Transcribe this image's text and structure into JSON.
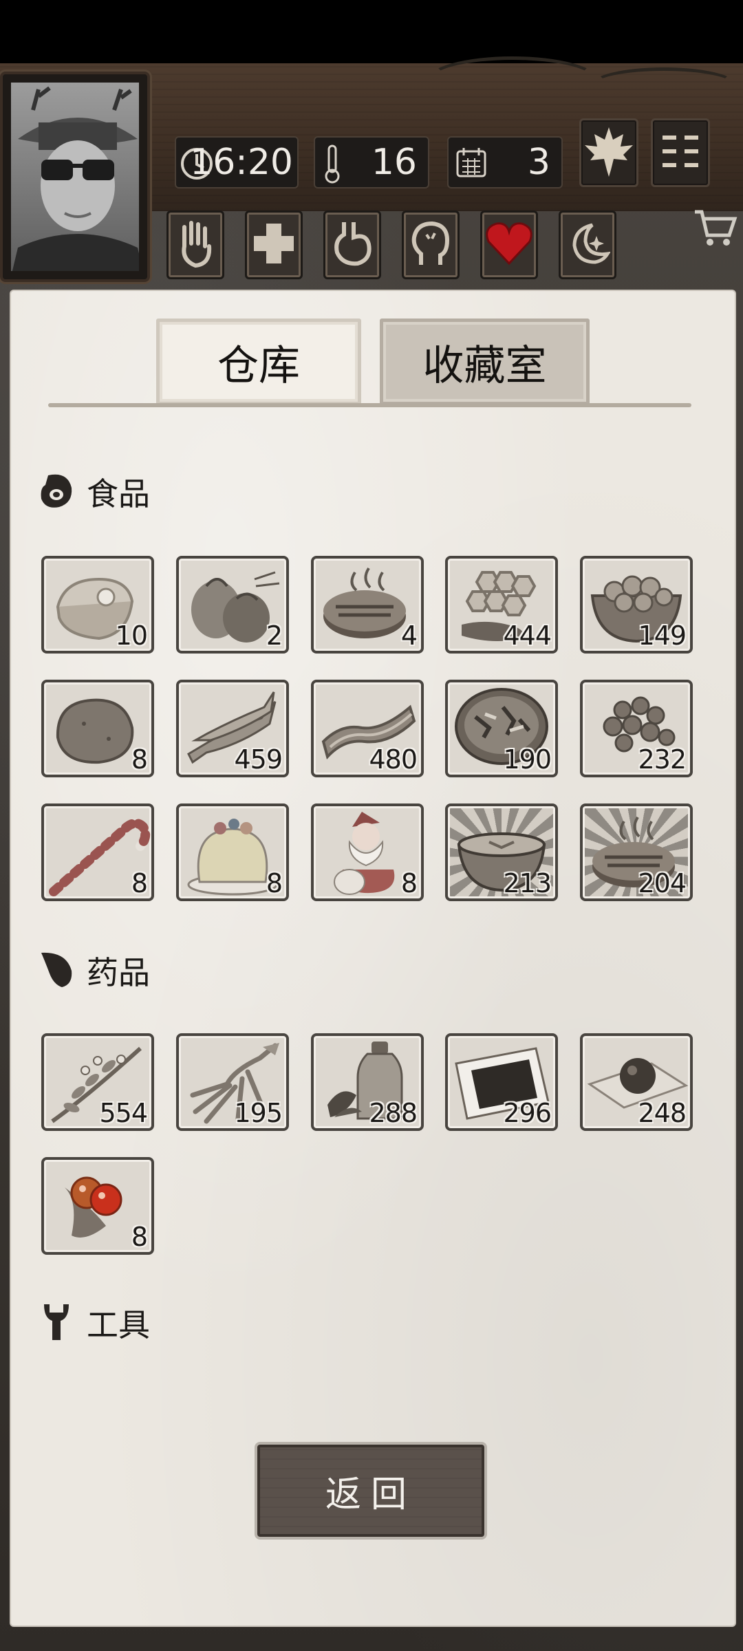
{
  "hud": {
    "time": "16:20",
    "temperature": "16",
    "day": "3",
    "icons": {
      "time": "clock-icon",
      "temperature": "thermometer-icon",
      "day": "calendar-icon",
      "season": "maple-leaf-icon",
      "menu": "menu-icon",
      "shop": "shopping-cart-icon"
    },
    "status": [
      "hand-icon",
      "health-cross-icon",
      "stomach-icon",
      "head-icon",
      "heart-icon",
      "moon-icon"
    ],
    "colors": {
      "heart": "#c0171d",
      "wood": "#3e2f24",
      "paper": "#ece8e1"
    }
  },
  "tabs": [
    {
      "label": "仓库",
      "active": true
    },
    {
      "label": "收藏室",
      "active": false
    }
  ],
  "sections": {
    "food": {
      "label": "食品",
      "icon": "meat-icon",
      "items": [
        {
          "icon": "raw-meat-icon",
          "count": "10"
        },
        {
          "icon": "coconut-icon",
          "count": "2"
        },
        {
          "icon": "grilled-steak-icon",
          "count": "4"
        },
        {
          "icon": "honeycomb-icon",
          "count": "444"
        },
        {
          "icon": "nut-bowl-icon",
          "count": "149"
        },
        {
          "icon": "potato-icon",
          "count": "8"
        },
        {
          "icon": "dried-fish-icon",
          "count": "459"
        },
        {
          "icon": "bacon-icon",
          "count": "480"
        },
        {
          "icon": "salad-bowl-icon",
          "count": "190"
        },
        {
          "icon": "berries-icon",
          "count": "232"
        },
        {
          "icon": "candy-cane-icon",
          "count": "8"
        },
        {
          "icon": "pudding-cake-icon",
          "count": "8"
        },
        {
          "icon": "santa-icon",
          "count": "8"
        },
        {
          "icon": "soup-bowl-icon",
          "count": "213"
        },
        {
          "icon": "grilled-steak-icon",
          "count": "204"
        }
      ]
    },
    "medicine": {
      "label": "药品",
      "icon": "leaf-icon",
      "items": [
        {
          "icon": "herb-branch-icon",
          "count": "554"
        },
        {
          "icon": "ginseng-root-icon",
          "count": "195"
        },
        {
          "icon": "tonic-bottle-icon",
          "count": "288"
        },
        {
          "icon": "plaster-icon",
          "count": "296"
        },
        {
          "icon": "pill-ball-icon",
          "count": "248"
        },
        {
          "icon": "red-berries-icon",
          "count": "8"
        }
      ]
    },
    "tools": {
      "label": "工具",
      "icon": "wrench-icon"
    }
  },
  "back_button": {
    "label": "返回"
  }
}
